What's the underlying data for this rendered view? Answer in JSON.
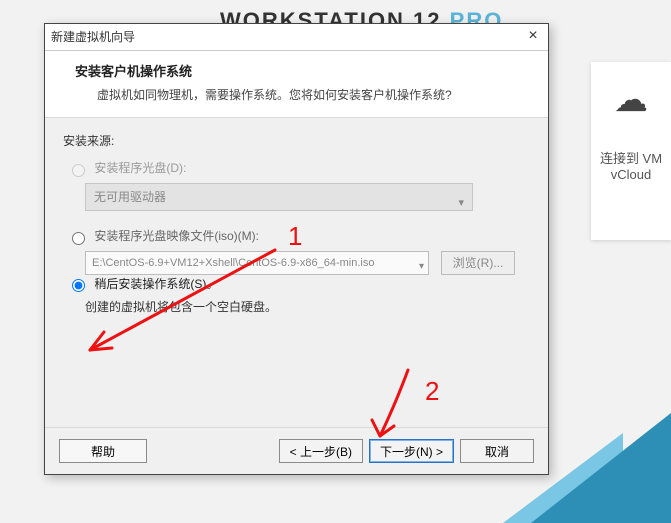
{
  "background": {
    "title_a": "WORKSTATION 12",
    "title_b": "PRO",
    "side_line1": "连接到 VM",
    "side_line2": "vCloud"
  },
  "dialog": {
    "title": "新建虚拟机向导",
    "header_title": "安装客户机操作系统",
    "header_sub": "虚拟机如同物理机，需要操作系统。您将如何安装客户机操作系统?",
    "source_label": "安装来源:",
    "opt_disc": "安装程序光盘(D):",
    "disc_dropdown": "无可用驱动器",
    "opt_iso": "安装程序光盘映像文件(iso)(M):",
    "iso_path": "E:\\CentOS-6.9+VM12+Xshell\\CentOS-6.9-x86_64-min.iso",
    "browse": "浏览(R)...",
    "opt_later": "稍后安装操作系统(S)。",
    "later_hint": "创建的虚拟机将包含一个空白硬盘。",
    "buttons": {
      "help": "帮助",
      "back": "< 上一步(B)",
      "next": "下一步(N) >",
      "cancel": "取消"
    }
  },
  "annotations": {
    "mark1": "1",
    "mark2": "2"
  }
}
